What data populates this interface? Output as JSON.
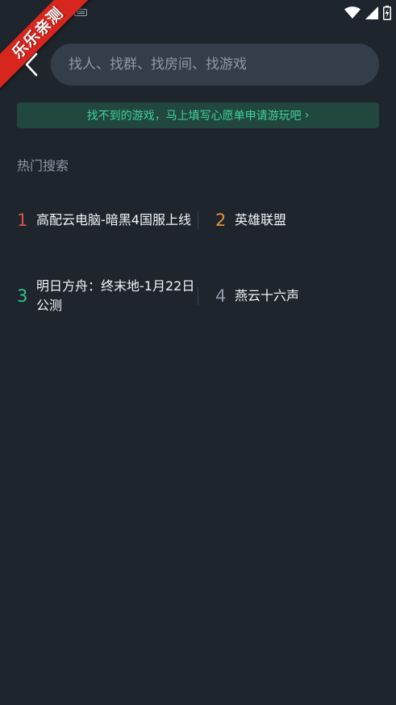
{
  "watermark": "乐乐亲测",
  "status_bar": {
    "icons": [
      "keyboard-icon",
      "wifi-icon",
      "signal-icon",
      "battery-icon"
    ]
  },
  "search": {
    "placeholder": "找人、找群、找房间、找游戏",
    "value": ""
  },
  "banner": {
    "text": "找不到的游戏，马上填写心愿单申请游玩吧",
    "chevron": "›"
  },
  "hot_section": {
    "title": "热门搜索",
    "items": [
      {
        "rank": "1",
        "name": "高配云电脑-暗黑4国服上线",
        "rank_color": "#e0504a"
      },
      {
        "rank": "2",
        "name": "英雄联盟",
        "rank_color": "#e9903a"
      },
      {
        "rank": "3",
        "name": "明日方舟：终末地-1月22日公测",
        "rank_color": "#2fc58a"
      },
      {
        "rank": "4",
        "name": "燕云十六声",
        "rank_color": "#8e98a5"
      }
    ]
  },
  "colors": {
    "background": "#1e252d",
    "search_bg": "#343e4b",
    "accent_green": "#3ed29a",
    "banner_bg": "#21473f",
    "watermark_red": "#d7261e"
  }
}
